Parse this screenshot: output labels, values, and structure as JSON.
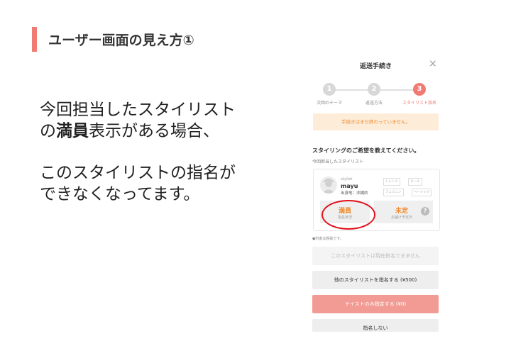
{
  "slide": {
    "title": "ユーザー画面の見え方①",
    "para1": {
      "line1": "今回担当したスタイリスト",
      "line2_prefix": "の",
      "line2_bold": "満員",
      "line2_suffix": "表示がある場合、"
    },
    "para2": {
      "line1": "このスタイリストの指名が",
      "line2": "できなくなってます。"
    }
  },
  "panel": {
    "header": "返送手続き",
    "close_icon": "×",
    "steps": [
      {
        "number": "1",
        "label": "次回のテーマ",
        "state": "done"
      },
      {
        "number": "2",
        "label": "返送方法",
        "state": "done"
      },
      {
        "number": "3",
        "label": "スタイリスト指名",
        "state": "active"
      }
    ],
    "notice": "手続きはまだ終わっていません。",
    "question": "スタイリングのご希望を教えてください。",
    "sub_label": "今回担当したスタイリスト",
    "stylist": {
      "role": "stylist",
      "name": "mayu",
      "origin": "出身地：沖縄県",
      "tags": [
        "トレンド",
        "クール",
        "フェミニン",
        "ベーシック"
      ]
    },
    "status_full": {
      "value": "満員",
      "label": "指名状況"
    },
    "status_delivery": {
      "value": "未定",
      "label": "お届け予定日"
    },
    "help_icon": "?",
    "fee_note": "●料金は税抜です。",
    "options": {
      "disabled": "このスタイリストは現在指名できません",
      "other": "他のスタイリストを指名する (¥500)",
      "taste": "テイストのみ指定する (¥0)",
      "none": "指名しない"
    }
  },
  "colors": {
    "accent": "#f07b73",
    "orange": "#f0892c",
    "highlight": "#e0121c"
  }
}
